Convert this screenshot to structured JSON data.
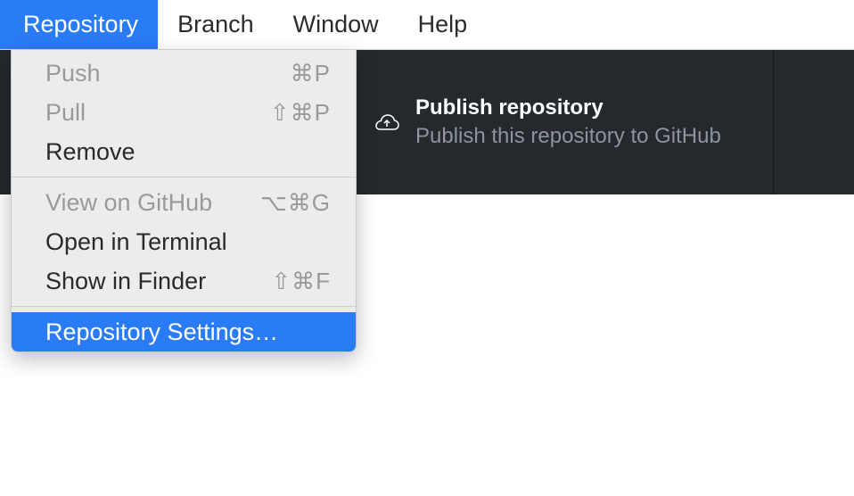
{
  "menubar": {
    "items": [
      {
        "label": "Repository",
        "active": true
      },
      {
        "label": "Branch",
        "active": false
      },
      {
        "label": "Window",
        "active": false
      },
      {
        "label": "Help",
        "active": false
      }
    ]
  },
  "toolbar": {
    "publish": {
      "title": "Publish repository",
      "subtitle": "Publish this repository to GitHub"
    }
  },
  "dropdown": {
    "groups": [
      [
        {
          "label": "Push",
          "shortcut": "⌘P",
          "disabled": true
        },
        {
          "label": "Pull",
          "shortcut": "⇧⌘P",
          "disabled": true
        },
        {
          "label": "Remove",
          "shortcut": "",
          "disabled": false
        }
      ],
      [
        {
          "label": "View on GitHub",
          "shortcut": "⌥⌘G",
          "disabled": true
        },
        {
          "label": "Open in Terminal",
          "shortcut": "",
          "disabled": false
        },
        {
          "label": "Show in Finder",
          "shortcut": "⇧⌘F",
          "disabled": false
        }
      ],
      [
        {
          "label": "Repository Settings…",
          "shortcut": "",
          "disabled": false,
          "highlighted": true
        }
      ]
    ]
  }
}
